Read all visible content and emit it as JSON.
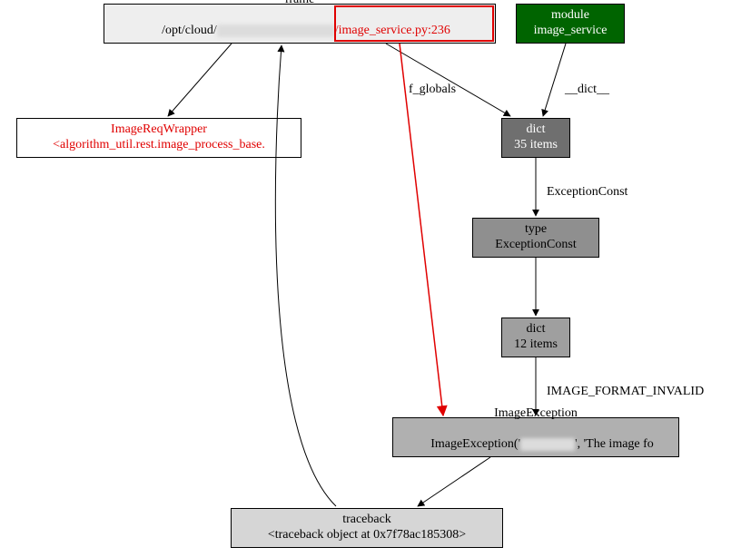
{
  "nodes": {
    "frame": {
      "title": "frame",
      "path_prefix": "/opt/cloud/",
      "path_suffix": "/image_service.py:236"
    },
    "module": {
      "line1": "module",
      "line2": "image_service"
    },
    "wrapper": {
      "line1": "ImageReqWrapper",
      "line2": "<algorithm_util.rest.image_process_base."
    },
    "dict35": {
      "line1": "dict",
      "line2": "35 items"
    },
    "type": {
      "line1": "type",
      "line2": "ExceptionConst"
    },
    "dict12": {
      "line1": "dict",
      "line2": "12 items"
    },
    "exc": {
      "line1": "ImageException",
      "line2_prefix": "ImageException('",
      "line2_suffix": "', 'The image fo"
    },
    "tb": {
      "line1": "traceback",
      "line2": "<traceback object at 0x7f78ac185308>"
    }
  },
  "edges": {
    "f_globals": "f_globals",
    "dict_attr": "__dict__",
    "exc_const": "ExceptionConst",
    "img_fmt": "IMAGE_FORMAT_INVALID"
  }
}
